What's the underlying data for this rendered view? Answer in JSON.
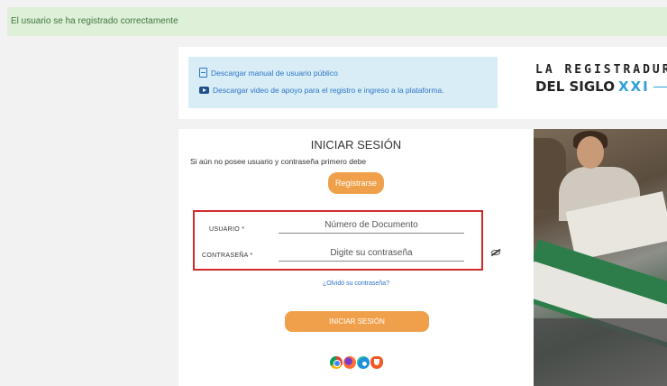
{
  "alert": {
    "text": "El usuario se ha registrado correctamente"
  },
  "links": {
    "manual": "Descargar manual de usuario público",
    "video": "Descargar video de apoyo para el registro e ingreso a la plataforma."
  },
  "brand": {
    "line1": "LA REGISTRADURÍA",
    "line2_prefix": "DEL SIGLO",
    "line2_accent": "XXI"
  },
  "login": {
    "title": "INICIAR SESIÓN",
    "subtitle": "Si aún no posee usuario y contraseña primero debe",
    "register_label": "Registrarse",
    "user_label": "USUARIO *",
    "user_placeholder": "Número de Documento",
    "password_label": "CONTRASEÑA *",
    "password_placeholder": "Digite su contraseña",
    "forgot_label": "¿Olvidó su contraseña?",
    "submit_label": "INICIAR SESIÓN"
  },
  "colors": {
    "accent": "#f0a04b",
    "alert_bg": "#dff0d8",
    "info_bg": "#d9edf7",
    "link": "#2e74c4",
    "highlight": "#d22a2a"
  },
  "icons": [
    "pdf-icon",
    "video-icon",
    "eye-icon",
    "chrome-icon",
    "firefox-icon",
    "edge-icon",
    "brave-icon"
  ]
}
